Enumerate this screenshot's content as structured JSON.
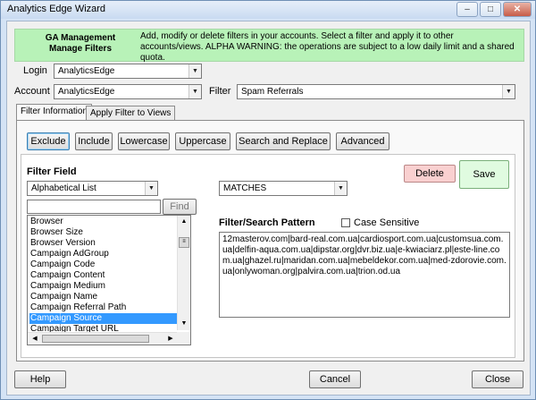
{
  "window": {
    "title": "Analytics Edge Wizard"
  },
  "banner": {
    "title_line1": "GA Management",
    "title_line2": "Manage Filters",
    "text": "Add, modify or delete filters in your accounts. Select a filter and apply it to other accounts/views. ALPHA WARNING: the operations are subject to a low daily limit and a shared quota."
  },
  "login": {
    "label": "Login",
    "value": "AnalyticsEdge"
  },
  "account": {
    "label": "Account",
    "value": "AnalyticsEdge"
  },
  "filter": {
    "label": "Filter",
    "value": "Spam Referrals"
  },
  "tabs": [
    {
      "label": "Filter Information",
      "active": true
    },
    {
      "label": "Apply Filter to Views",
      "active": false
    }
  ],
  "type_buttons": [
    "Exclude",
    "Include",
    "Lowercase",
    "Uppercase",
    "Search and Replace",
    "Advanced"
  ],
  "selected_type": "Exclude",
  "filter_field": {
    "label": "Filter Field",
    "list_type": "Alphabetical List",
    "search_value": "",
    "find_label": "Find",
    "items": [
      "Browser",
      "Browser Size",
      "Browser Version",
      "Campaign AdGroup",
      "Campaign Code",
      "Campaign Content",
      "Campaign Medium",
      "Campaign Name",
      "Campaign Referral Path",
      "Campaign Source",
      "Campaign Target URL"
    ],
    "selected_item": "Campaign Source"
  },
  "match_type": "MATCHES",
  "actions": {
    "delete_label": "Delete",
    "save_label": "Save"
  },
  "pattern": {
    "label": "Filter/Search Pattern",
    "case_sensitive_label": "Case Sensitive",
    "case_sensitive": false,
    "value": "12masterov.com|bard-real.com.ua|cardiosport.com.ua|customsua.com.ua|delfin-aqua.com.ua|dipstar.org|dvr.biz.ua|e-kwiaciarz.pl|este-line.com.ua|ghazel.ru|maridan.com.ua|mebeldekor.com.ua|med-zdorovie.com.ua|onlywoman.org|palvira.com.ua|trion.od.ua"
  },
  "footer": {
    "help_label": "Help",
    "cancel_label": "Cancel",
    "close_label": "Close"
  },
  "colors": {
    "banner": "#b8f2b8",
    "selection": "#3399ff",
    "delete": "#f9d0d0",
    "save": "#e0fbe0"
  }
}
